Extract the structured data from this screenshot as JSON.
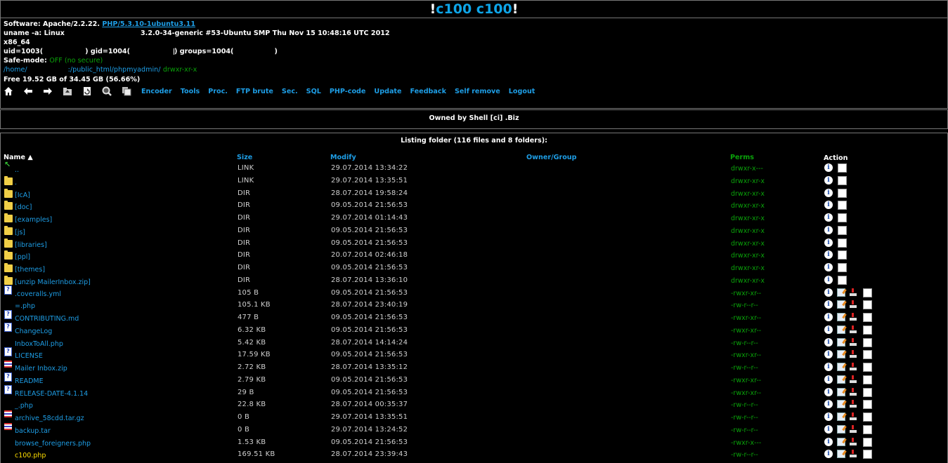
{
  "title": {
    "left": "!",
    "main": "c100 c100",
    "right": "!"
  },
  "info": {
    "software_label": "Software:",
    "software_value": "Apache/2.2.22.",
    "php_link": "PHP/5.3.10-1ubuntu3.11",
    "uname_label": "uname -a:",
    "uname_value": "Linux",
    "uname_rest": "3.2.0-34-generic #53-Ubuntu SMP Thu Nov 15 10:48:16 UTC 2012",
    "arch": "x86_64",
    "uid": "uid=1003(",
    "gid": ") gid=1004(",
    "groups": ") groups=1004(",
    "groups_end": ")",
    "safe_mode_label": "Safe-mode:",
    "safe_mode_value": "OFF (no secure)",
    "path_start": "/home/",
    "path_end": ":/public_html/phpmyadmin/",
    "path_perm": "drwxr-xr-x",
    "free": "Free 19.52 GB of 34.45 GB (56.66%)"
  },
  "toolbar": {
    "icons": [
      "home-icon",
      "back-icon",
      "forward-icon",
      "upload-icon",
      "refresh-icon",
      "search-icon",
      "buffer-icon"
    ],
    "links": [
      "Encoder",
      "Tools",
      "Proc.",
      "FTP brute",
      "Sec.",
      "SQL",
      "PHP-code",
      "Update",
      "Feedback",
      "Self remove",
      "Logout"
    ]
  },
  "owned": "Owned by Shell [ci] .Biz",
  "listing": {
    "title": "Listing folder (116 files and 8 folders):",
    "headers": {
      "name": "Name ▲",
      "size": "Size",
      "modify": "Modify",
      "owner": "Owner/Group",
      "perms": "Perms",
      "action": "Action"
    },
    "rows": [
      {
        "type": "up",
        "name": "..",
        "size": "LINK",
        "date": "29.07.2014 13:34:22",
        "perm": "drwxr-x---"
      },
      {
        "type": "folder",
        "name": ".",
        "size": "LINK",
        "date": "29.07.2014 13:35:51",
        "perm": "drwxr-xr-x"
      },
      {
        "type": "folder",
        "name": "[IcA]",
        "size": "DIR",
        "date": "28.07.2014 19:58:24",
        "perm": "drwxr-xr-x"
      },
      {
        "type": "folder",
        "name": "[doc]",
        "size": "DIR",
        "date": "09.05.2014 21:56:53",
        "perm": "drwxr-xr-x"
      },
      {
        "type": "folder",
        "name": "[examples]",
        "size": "DIR",
        "date": "29.07.2014 01:14:43",
        "perm": "drwxr-xr-x"
      },
      {
        "type": "folder",
        "name": "[js]",
        "size": "DIR",
        "date": "09.05.2014 21:56:53",
        "perm": "drwxr-xr-x"
      },
      {
        "type": "folder",
        "name": "[libraries]",
        "size": "DIR",
        "date": "09.05.2014 21:56:53",
        "perm": "drwxr-xr-x"
      },
      {
        "type": "folder",
        "name": "[ppl]",
        "size": "DIR",
        "date": "20.07.2014 02:46:18",
        "perm": "drwxr-xr-x"
      },
      {
        "type": "folder",
        "name": "[themes]",
        "size": "DIR",
        "date": "09.05.2014 21:56:53",
        "perm": "drwxr-xr-x"
      },
      {
        "type": "folder",
        "name": "[unzip MailerInbox.zip]",
        "size": "DIR",
        "date": "28.07.2014 13:36:10",
        "perm": "drwxr-xr-x"
      },
      {
        "type": "doc",
        "name": ".coveralls.yml",
        "size": "105 B",
        "date": "09.05.2014 21:56:53",
        "perm": "-rwxr-xr--"
      },
      {
        "type": "none",
        "name": "=.php",
        "size": "105.1 KB",
        "date": "28.07.2014 23:40:19",
        "perm": "-rw-r--r--"
      },
      {
        "type": "doc",
        "name": "CONTRIBUTING.md",
        "size": "477 B",
        "date": "09.05.2014 21:56:53",
        "perm": "-rwxr-xr--"
      },
      {
        "type": "doc",
        "name": "ChangeLog",
        "size": "6.32 KB",
        "date": "09.05.2014 21:56:53",
        "perm": "-rwxr-xr--"
      },
      {
        "type": "none",
        "name": "InboxToAll.php",
        "size": "5.42 KB",
        "date": "28.07.2014 14:14:24",
        "perm": "-rw-r--r--"
      },
      {
        "type": "doc",
        "name": "LICENSE",
        "size": "17.59 KB",
        "date": "09.05.2014 21:56:53",
        "perm": "-rwxr-xr--"
      },
      {
        "type": "archive",
        "name": "Mailer Inbox.zip",
        "size": "2.72 KB",
        "date": "28.07.2014 13:35:12",
        "perm": "-rw-r--r--"
      },
      {
        "type": "doc",
        "name": "README",
        "size": "2.79 KB",
        "date": "09.05.2014 21:56:53",
        "perm": "-rwxr-xr--"
      },
      {
        "type": "doc",
        "name": "RELEASE-DATE-4.1.14",
        "size": "29 B",
        "date": "09.05.2014 21:56:53",
        "perm": "-rwxr-xr--"
      },
      {
        "type": "none",
        "name": "_.php",
        "size": "22.8 KB",
        "date": "28.07.2014 00:35:37",
        "perm": "-rw-r--r--"
      },
      {
        "type": "archive",
        "name": "archive_58cdd.tar.gz",
        "size": "0 B",
        "date": "29.07.2014 13:35:51",
        "perm": "-rw-r--r--"
      },
      {
        "type": "archive",
        "name": "backup.tar",
        "size": "0 B",
        "date": "29.07.2014 13:24:52",
        "perm": "-rw-r--r--"
      },
      {
        "type": "none",
        "name": "browse_foreigners.php",
        "size": "1.53 KB",
        "date": "09.05.2014 21:56:53",
        "perm": "-rwxr-x---"
      },
      {
        "type": "none",
        "name": "c100.php",
        "size": "169.51 KB",
        "date": "28.07.2014 23:39:43",
        "perm": "-rw-r--r--",
        "highlight": true
      }
    ]
  },
  "colors": {
    "accent": "#1e9ee6",
    "perm_green": "#0aa20a",
    "folder": "#f1cf47",
    "background": "#000000"
  }
}
